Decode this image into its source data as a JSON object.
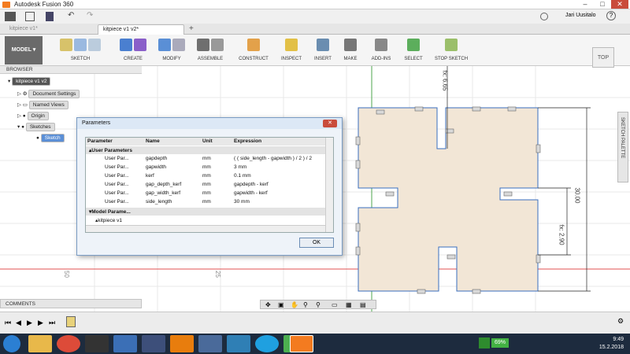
{
  "window": {
    "title": "Autodesk Fusion 360",
    "user": "Jari Uusitalo"
  },
  "tabs": [
    {
      "label": "kitpiece v1*"
    },
    {
      "label": "kitpiece v1 v2*"
    }
  ],
  "workspace": {
    "label": "MODEL"
  },
  "ribbon": {
    "groups": [
      "SKETCH",
      "CREATE",
      "MODIFY",
      "ASSEMBLE",
      "CONSTRUCT",
      "INSPECT",
      "INSERT",
      "MAKE",
      "ADD-INS",
      "SELECT",
      "STOP SKETCH"
    ]
  },
  "browser": {
    "title": "BROWSER",
    "items": [
      "kitpiece v1 v2",
      "Document Settings",
      "Named Views",
      "Origin",
      "Sketches",
      "Sketch"
    ]
  },
  "dialog": {
    "title": "Parameters",
    "headers": [
      "Parameter",
      "Name",
      "Unit",
      "Expression"
    ],
    "user_section": "User Parameters",
    "rows": [
      {
        "param": "User Par...",
        "name": "gapdepth",
        "unit": "mm",
        "expr": "( ( side_length - gapwidth ) / 2 ) / 2"
      },
      {
        "param": "User Par...",
        "name": "gapwidth",
        "unit": "mm",
        "expr": "3 mm"
      },
      {
        "param": "User Par...",
        "name": "kerf",
        "unit": "mm",
        "expr": "0.1 mm"
      },
      {
        "param": "User Par...",
        "name": "gap_depth_kerf",
        "unit": "mm",
        "expr": "gapdepth - kerf"
      },
      {
        "param": "User Par...",
        "name": "gap_width_kerf",
        "unit": "mm",
        "expr": "gapwidth - kerf"
      },
      {
        "param": "User Par...",
        "name": "side_length",
        "unit": "mm",
        "expr": "30 mm"
      }
    ],
    "model_section": "Model Parame...",
    "model_item": "kitpiece v1",
    "ok": "OK"
  },
  "canvas": {
    "dim_vertical_top": "fx: 6.65",
    "dim_side": "30.00",
    "dim_right": "fx: 2.90",
    "ruler_a": "50",
    "ruler_b": "25",
    "viewcube": "TOP",
    "sketch_palette": "SKETCH PALETTE"
  },
  "comments": {
    "label": "COMMENTS"
  },
  "clock": {
    "time": "9:49",
    "date": "15.2.2018",
    "battery": "69%"
  },
  "colors": {
    "accent": "#1d7bd4",
    "sketch_fill": "#f2e6d6",
    "sketch_line": "#3a6fbf"
  }
}
